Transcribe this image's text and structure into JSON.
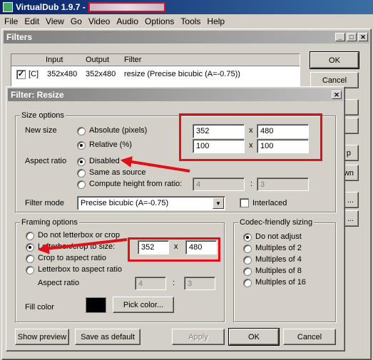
{
  "main_window": {
    "title": "VirtualDub 1.9.7 -",
    "menu": [
      "File",
      "Edit",
      "View",
      "Go",
      "Video",
      "Audio",
      "Options",
      "Tools",
      "Help"
    ]
  },
  "filters_window": {
    "title": "Filters",
    "columns": [
      "Input",
      "Output",
      "Filter"
    ],
    "row": {
      "checked_label": "[C]",
      "input": "352x480",
      "output": "352x480",
      "filter": "resize (Precise bicubic (A=-0.75))"
    },
    "ok_label": "OK",
    "cancel_label": "Cancel",
    "partial_buttons": [
      "p",
      "wn",
      "...",
      "..."
    ]
  },
  "resize_dialog": {
    "title": "Filter: Resize",
    "size_options": {
      "title": "Size options",
      "new_size_label": "New size",
      "absolute_label": "Absolute (pixels)",
      "relative_label": "Relative (%)",
      "abs_width": "352",
      "abs_height": "480",
      "rel_width": "100",
      "rel_height": "100",
      "x_sep": "x",
      "aspect_ratio_label": "Aspect ratio",
      "disabled_label": "Disabled",
      "same_as_source_label": "Same as source",
      "compute_height_label": "Compute height from ratio:",
      "ratio_a": "4",
      "ratio_b": "3",
      "colon": ":",
      "filter_mode_label": "Filter mode",
      "filter_mode_value": "Precise bicubic (A=-0.75)",
      "interlaced_label": "Interlaced"
    },
    "framing_options": {
      "title": "Framing options",
      "no_letterbox_label": "Do not letterbox or crop",
      "letterbox_crop_label": "Letterbox/crop to size:",
      "crop_aspect_label": "Crop to aspect ratio",
      "letterbox_aspect_label": "Letterbox to aspect ratio",
      "frame_width": "352",
      "frame_height": "480",
      "x_sep": "x",
      "aspect_ratio_label": "Aspect ratio",
      "aspect_a": "4",
      "aspect_b": "3",
      "colon": ":",
      "fill_color_label": "Fill color",
      "pick_color_label": "Pick color...",
      "fill_color": "#000000"
    },
    "codec_sizing": {
      "title": "Codec-friendly sizing",
      "options": [
        "Do not adjust",
        "Multiples of 2",
        "Multiples of 4",
        "Multiples of 8",
        "Multiples of 16"
      ]
    },
    "buttons": {
      "show_preview": "Show preview",
      "save_default": "Save as default",
      "apply": "Apply",
      "ok": "OK",
      "cancel": "Cancel"
    }
  },
  "colors": {
    "highlight": "#e0101a",
    "titlebar": "#0a246a",
    "face": "#d4d0c8"
  }
}
